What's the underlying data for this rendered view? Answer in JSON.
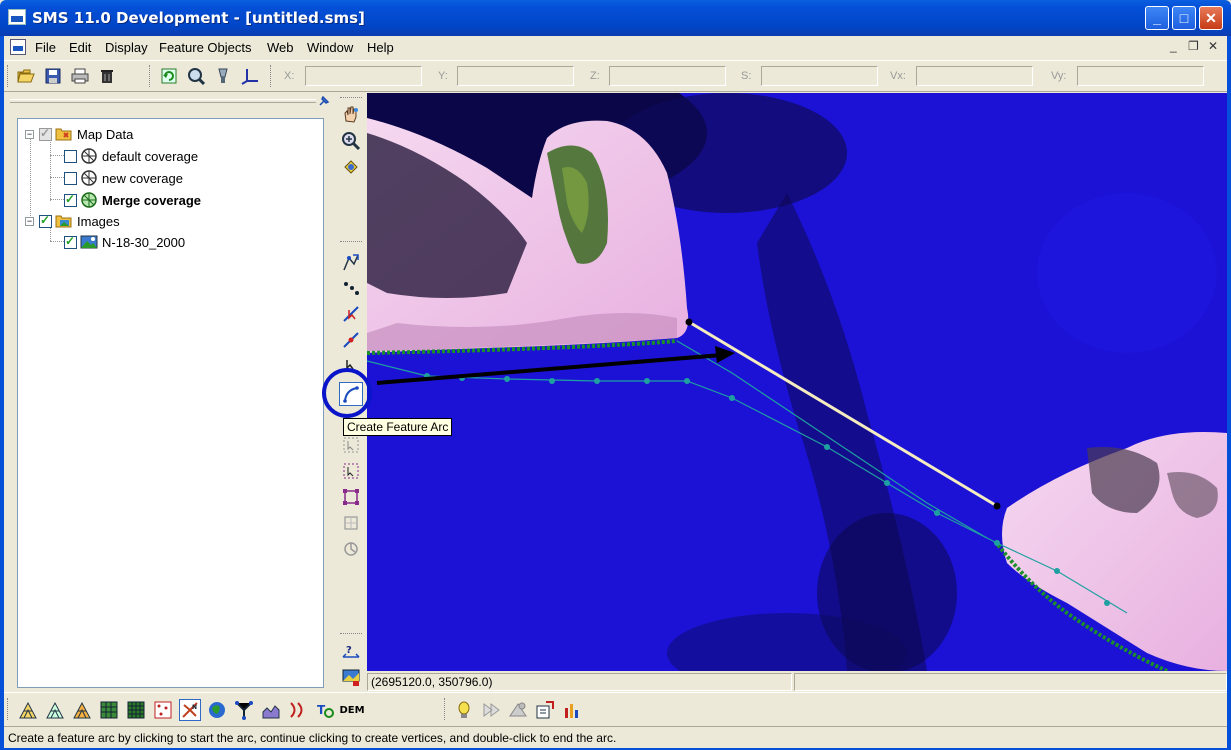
{
  "window": {
    "title": "SMS 11.0 Development - [untitled.sms]",
    "minimize_glyph": "_",
    "maximize_glyph": "□",
    "close_glyph": "✕"
  },
  "menu": {
    "items": [
      "File",
      "Edit",
      "Display",
      "Feature Objects",
      "Web",
      "Window",
      "Help"
    ],
    "mdi_controls": [
      "_",
      "❐",
      "✕"
    ]
  },
  "coords": {
    "labels": [
      "X:",
      "Y:",
      "Z:",
      "S:",
      "Vx:",
      "Vy:"
    ],
    "values": [
      "",
      "",
      "",
      "",
      "",
      ""
    ]
  },
  "tree": {
    "map_data": "Map Data",
    "default_coverage": "default coverage",
    "new_coverage": "new coverage",
    "merge_coverage": "Merge coverage",
    "images": "Images",
    "image_item": "N-18-30_2000",
    "collapse_glyph": "−"
  },
  "tooltip": "Create Feature Arc",
  "status": {
    "cursor_coords": "(2695120.0, 350796.0)",
    "message": "Create a feature arc by clicking to start the arc, continue clicking to create vertices, and double-click to end the arc."
  },
  "bottom_toolbar": {
    "dem_label": "DEM"
  },
  "colors": {
    "titlebar": "#0550d8",
    "water": "#1b12d6",
    "arc_line": "#f5ecc0",
    "coastline": "#1a8f2a",
    "highlight": "#0a14c8"
  }
}
